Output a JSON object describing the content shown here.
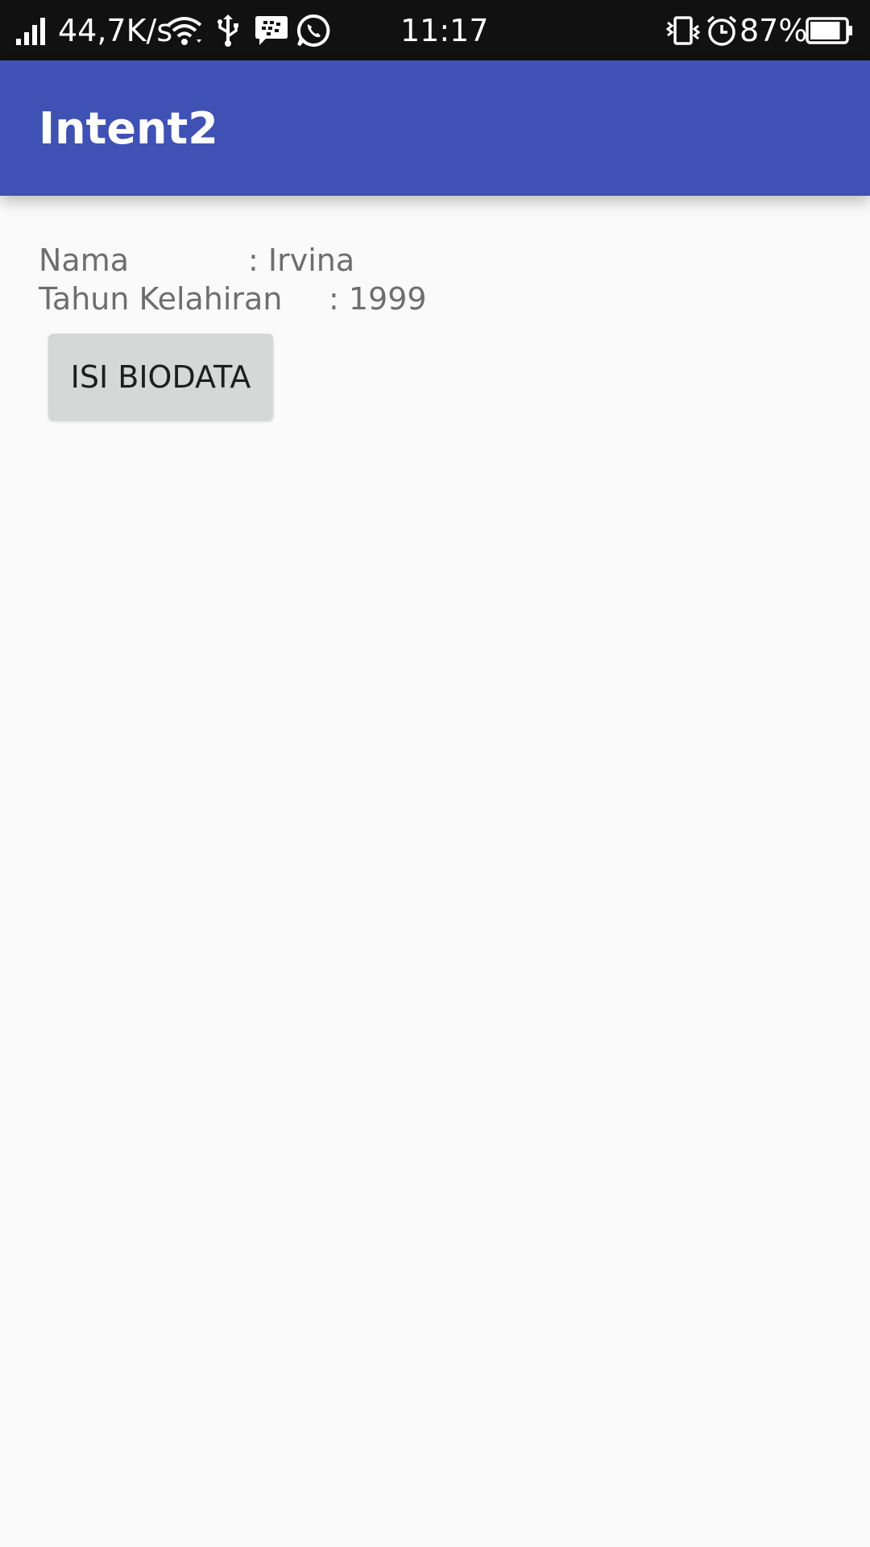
{
  "status_bar": {
    "network_speed": "44,7K/s",
    "time": "11:17",
    "battery_percent": "87%",
    "battery_level": 0.87,
    "icons": [
      "signal-icon",
      "wifi-icon",
      "usb-icon",
      "bbm-icon",
      "whatsapp-icon",
      "vibrate-icon",
      "alarm-icon",
      "battery-icon"
    ]
  },
  "app_bar": {
    "title": "Intent2",
    "color": "#3f51b5"
  },
  "content": {
    "nama_label": "Nama",
    "nama_value": ": Irvina",
    "tahun_label": "Tahun Kelahiran",
    "tahun_value": ": 1999",
    "button_label": "ISI BIODATA"
  }
}
